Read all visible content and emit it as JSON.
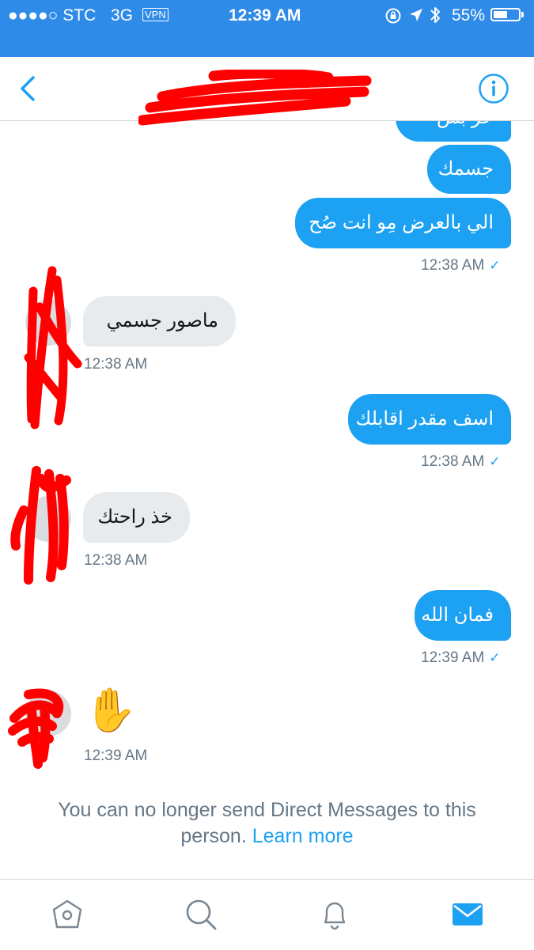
{
  "status_bar": {
    "carrier": "●●●●○ STC",
    "network": "3G",
    "vpn": "VPN",
    "time": "12:39 AM",
    "battery_percent": "55%",
    "battery_level": 0.55
  },
  "navbar": {
    "back_icon": "chevron-left-icon",
    "info_icon": "info-circle-icon"
  },
  "messages": [
    {
      "direction": "outgoing",
      "text": "ﺣﺮ ﺑﺲ",
      "timestamp": ""
    },
    {
      "direction": "outgoing",
      "text": "جسمك",
      "timestamp": ""
    },
    {
      "direction": "outgoing",
      "text": "الي بالعرض مِو انت صُح",
      "timestamp": "12:38 AM"
    },
    {
      "direction": "incoming",
      "text": "ماصور جسمي",
      "timestamp": "12:38 AM"
    },
    {
      "direction": "outgoing",
      "text": "اسف مقدر اقابلك",
      "timestamp": "12:38 AM"
    },
    {
      "direction": "incoming",
      "text": "خذ راحتك",
      "timestamp": "12:38 AM"
    },
    {
      "direction": "outgoing",
      "text": "فمان الله",
      "timestamp": "12:39 AM"
    },
    {
      "direction": "incoming",
      "text": "✋",
      "timestamp": "12:39 AM"
    }
  ],
  "read_receipt": "✓",
  "notice": {
    "text": "You can no longer send Direct Messages to this person.",
    "link": "Learn more"
  },
  "tabbar": {
    "items": [
      "home-icon",
      "search-icon",
      "notifications-icon",
      "messages-icon"
    ],
    "active": "messages-icon"
  },
  "colors": {
    "status_bar": "#2f8be8",
    "accent": "#1da1f2",
    "incoming_bubble": "#e7ebee",
    "muted_text": "#657786",
    "redaction": "#ff0000"
  }
}
